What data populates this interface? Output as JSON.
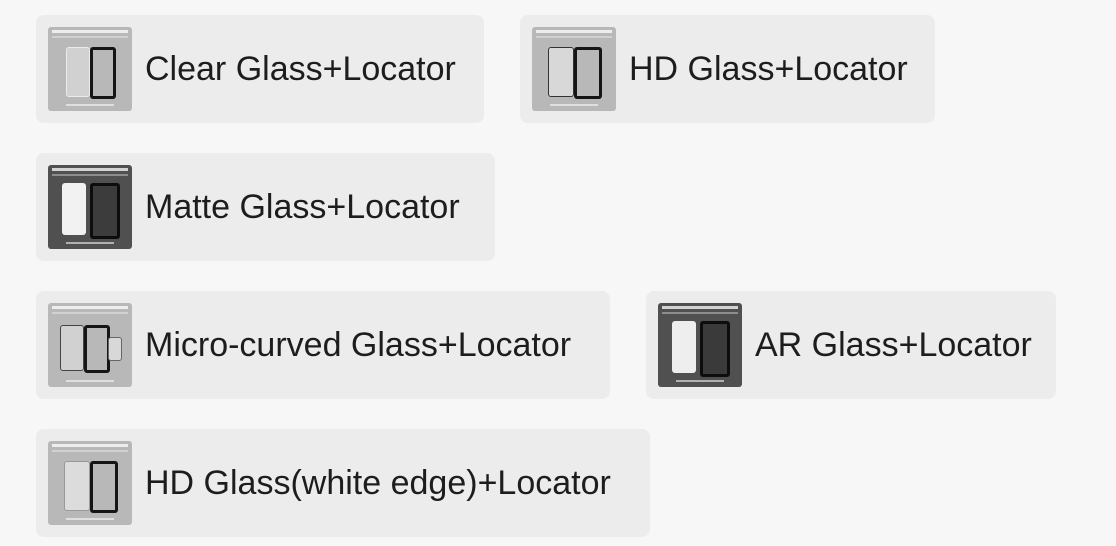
{
  "options": [
    {
      "label": "Clear Glass+Locator",
      "thumb_style": "light",
      "thumbnail_icon": "clear-glass-locator-thumbnail"
    },
    {
      "label": "HD Glass+Locator",
      "thumb_style": "light",
      "thumbnail_icon": "hd-glass-locator-thumbnail"
    },
    {
      "label": "Matte Glass+Locator",
      "thumb_style": "dark",
      "thumbnail_icon": "matte-glass-locator-thumbnail"
    },
    {
      "label": "Micro-curved Glass+Locator",
      "thumb_style": "light",
      "thumbnail_icon": "micro-curved-glass-locator-thumbnail"
    },
    {
      "label": "AR Glass+Locator",
      "thumb_style": "dark",
      "thumbnail_icon": "ar-glass-locator-thumbnail"
    },
    {
      "label": "HD Glass(white edge)+Locator",
      "thumb_style": "light",
      "thumbnail_icon": "hd-glass-white-edge-locator-thumbnail"
    }
  ],
  "colors": {
    "page_background": "#f7f7f7",
    "option_background": "#ececec",
    "label_text": "#1d1d1d"
  }
}
